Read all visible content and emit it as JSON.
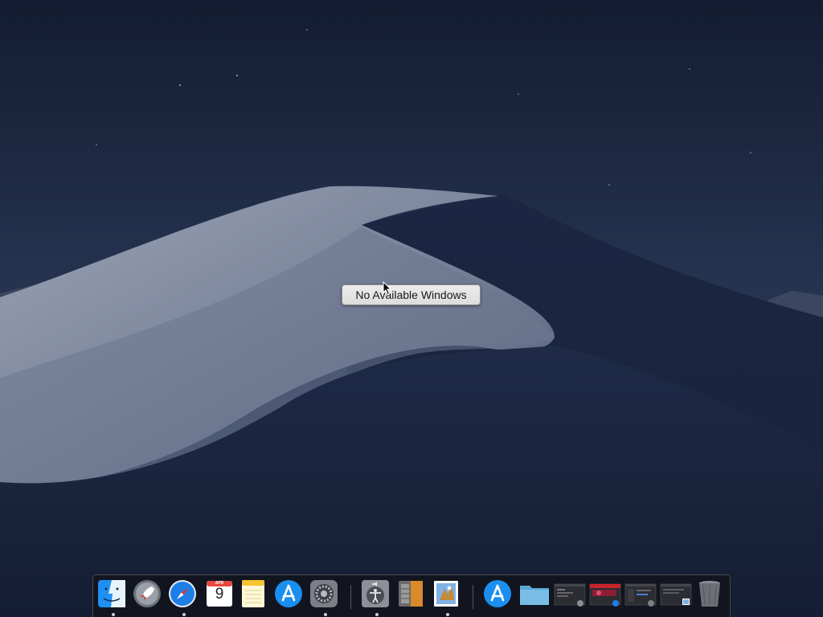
{
  "tooltip": {
    "text": "No Available Windows"
  },
  "dock": {
    "apps": [
      {
        "name": "Finder",
        "icon": "finder-icon",
        "running": true
      },
      {
        "name": "Launchpad",
        "icon": "launchpad-rocket-icon",
        "running": false
      },
      {
        "name": "Safari",
        "icon": "safari-compass-icon",
        "running": true
      },
      {
        "name": "Calendar",
        "icon": "calendar-icon",
        "running": false,
        "month": "APR",
        "day": "9"
      },
      {
        "name": "Notes",
        "icon": "notes-icon",
        "running": false
      },
      {
        "name": "App Store",
        "icon": "app-store-icon",
        "running": false
      },
      {
        "name": "System Preferences",
        "icon": "gear-icon",
        "running": true
      },
      {
        "name": "Accessibility",
        "icon": "accessibility-icon",
        "running": true
      },
      {
        "name": "Archive",
        "icon": "archive-icon",
        "running": false
      },
      {
        "name": "Preview",
        "icon": "preview-icon",
        "running": true
      }
    ],
    "others": [
      {
        "name": "App Store Downloads",
        "icon": "app-store-icon"
      },
      {
        "name": "Folder",
        "icon": "folder-icon"
      },
      {
        "name": "Window 1",
        "icon": "window-thumbnail-icon"
      },
      {
        "name": "Window 2",
        "icon": "window-thumbnail-icon"
      },
      {
        "name": "Window 3",
        "icon": "window-thumbnail-icon"
      },
      {
        "name": "Window 4",
        "icon": "window-thumbnail-icon"
      },
      {
        "name": "Trash",
        "icon": "trash-icon"
      }
    ]
  },
  "colors": {
    "sky_top": "#141d33",
    "sky_bottom": "#2c3a58",
    "dune_light": "#8e97ab",
    "dune_dark": "#1d2a45"
  }
}
